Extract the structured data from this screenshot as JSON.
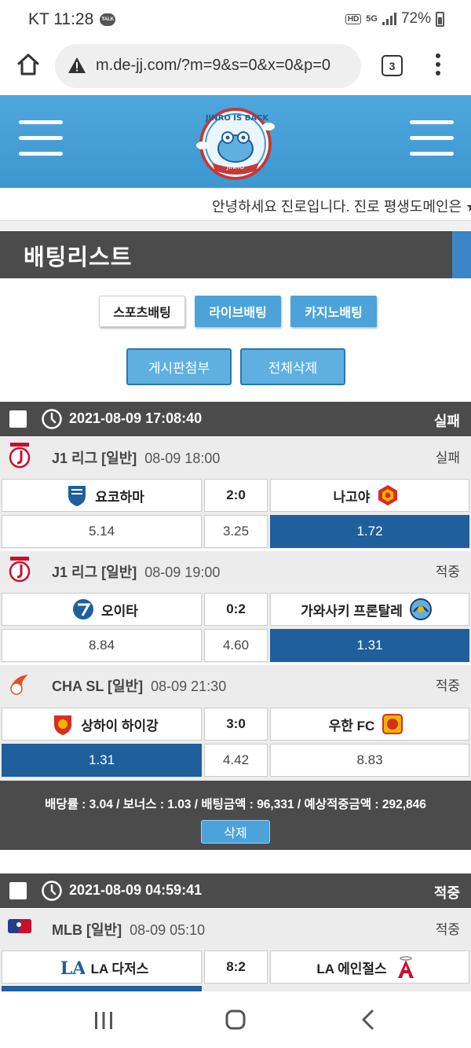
{
  "status_bar": {
    "carrier_time": "KT 11:28",
    "talk_label": "TALK",
    "hd": "HD",
    "net": "5G",
    "battery": "72%"
  },
  "browser": {
    "url": "m.de-jj.com/?m=9&s=0&x=0&p=0",
    "tab_count": "3"
  },
  "header": {
    "logo_text": "JINRO IS BACK",
    "logo_sub": "JINRO"
  },
  "ticker": {
    "text": "안녕하세요 진로입니다. 진로 평생도메인은 ★"
  },
  "page": {
    "title": "배팅리스트"
  },
  "tabs": [
    {
      "label": "스포츠배팅",
      "active": true
    },
    {
      "label": "라이브배팅",
      "active": false
    },
    {
      "label": "카지노배팅",
      "active": false
    }
  ],
  "actions": {
    "attach_label": "게시판첨부",
    "delete_all_label": "전체삭제"
  },
  "slips": [
    {
      "datetime": "2021-08-09 17:08:40",
      "status": "실패",
      "games": [
        {
          "league": "J1 리그 [일반]",
          "time": "08-09 18:00",
          "result": "실패",
          "home": "요코하마",
          "score": "2:0",
          "away": "나고야",
          "home_odds": "5.14",
          "draw_odds": "3.25",
          "away_odds": "1.72",
          "pick": "away"
        },
        {
          "league": "J1 리그 [일반]",
          "time": "08-09 19:00",
          "result": "적중",
          "home": "오이타",
          "score": "0:2",
          "away": "가와사키 프론탈레",
          "home_odds": "8.84",
          "draw_odds": "4.60",
          "away_odds": "1.31",
          "pick": "away"
        },
        {
          "league": "CHA SL [일반]",
          "time": "08-09 21:30",
          "result": "적중",
          "home": "상하이 하이강",
          "score": "3:0",
          "away": "우한 FC",
          "home_odds": "1.31",
          "draw_odds": "4.42",
          "away_odds": "8.83",
          "pick": "home"
        }
      ],
      "summary": "배당률 : 3.04 / 보너스 : 1.03 / 배팅금액 : 96,331 / 예상적중금액 : 292,846",
      "delete_label": "삭제"
    },
    {
      "datetime": "2021-08-09 04:59:41",
      "status": "적중",
      "games": [
        {
          "league": "MLB [일반]",
          "time": "08-09 05:10",
          "result": "적중",
          "home": "LA 다저스",
          "score": "8:2",
          "away": "LA 에인절스"
        }
      ]
    }
  ],
  "colors": {
    "header_blue": "#4ea7dc",
    "dark_bar": "#4b4b4b",
    "selected_odds": "#1f5f9c",
    "button_blue": "#4ba3da"
  }
}
